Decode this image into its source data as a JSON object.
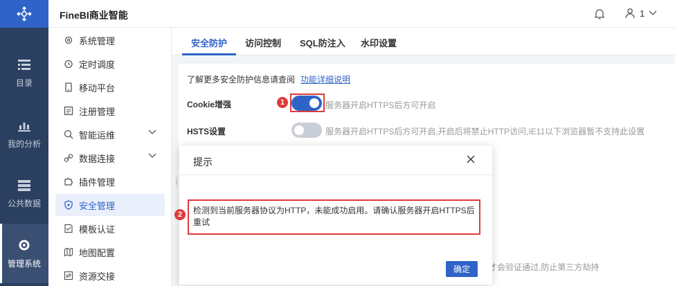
{
  "app": {
    "brand": "FineBI商业智能",
    "user_label": "1"
  },
  "rail": [
    {
      "label": "目录",
      "icon": "catalog-icon"
    },
    {
      "label": "我的分析",
      "icon": "analysis-icon"
    },
    {
      "label": "公共数据",
      "icon": "public-data-icon"
    },
    {
      "label": "管理系统",
      "icon": "gear-icon"
    }
  ],
  "sidebar": {
    "items": [
      {
        "label": "系统管理",
        "icon": "settings-icon"
      },
      {
        "label": "定时调度",
        "icon": "clock-icon"
      },
      {
        "label": "移动平台",
        "icon": "mobile-icon"
      },
      {
        "label": "注册管理",
        "icon": "register-icon"
      },
      {
        "label": "智能运维",
        "icon": "ops-icon"
      },
      {
        "label": "数据连接",
        "icon": "link-icon"
      },
      {
        "label": "插件管理",
        "icon": "plugin-icon"
      },
      {
        "label": "安全管理",
        "icon": "shield-icon"
      },
      {
        "label": "模板认证",
        "icon": "template-icon"
      },
      {
        "label": "地图配置",
        "icon": "map-icon"
      },
      {
        "label": "资源交接",
        "icon": "handover-icon"
      }
    ]
  },
  "tabs": [
    {
      "label": "安全防护"
    },
    {
      "label": "访问控制"
    },
    {
      "label": "SQL防注入"
    },
    {
      "label": "水印设置"
    }
  ],
  "security": {
    "intro": "了解更多安全防护信息请查阅",
    "intro_link": "功能详细说明",
    "cookie_label": "Cookie增强",
    "cookie_hint": "服务器开启HTTPS后方可开启",
    "cookie_on": true,
    "hsts_label": "HSTS设置",
    "hsts_hint": "服务器开启HTTPS后方可开启,开启后将禁止HTTP访问,IE11以下浏览器暂不支持此设置",
    "hsts_on": false,
    "bottom_hint": "才会验证通过,防止第三方劫持"
  },
  "annotations": {
    "badge1": "1",
    "badge2": "2"
  },
  "modal": {
    "title": "提示",
    "message": "检测到当前服务器协议为HTTP，未能成功启用。请确认服务器开启HTTPS后重试",
    "ok": "确定"
  },
  "colors": {
    "rail": "#2b3f60",
    "accent": "#2f63c8",
    "annotation": "#e0393b"
  }
}
